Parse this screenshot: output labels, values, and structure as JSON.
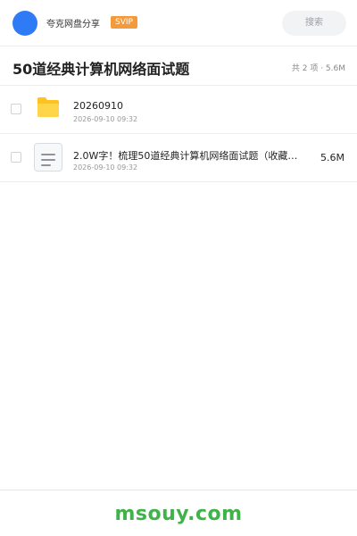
{
  "header": {
    "username": "夸克网盘分享",
    "badge": "SVIP",
    "search_placeholder": "搜索"
  },
  "titlebar": {
    "title": "50道经典计算机网络面试题",
    "meta": "共 2 项 · 5.6M"
  },
  "files": [
    {
      "type": "folder",
      "name": "20260910",
      "date": "2026-09-10 09:32",
      "size": ""
    },
    {
      "type": "document",
      "name": "2.0W字！梳理50道经典计算机网络面试题（收藏版…",
      "date": "2026-09-10 09:32",
      "size": "5.6M"
    }
  ],
  "footer": {
    "watermark": "msouy.com"
  },
  "colors": {
    "accent_blue": "#2f7bf5",
    "svip_orange": "#f39a3b",
    "folder_yellow": "#ffc31f",
    "watermark_green": "#3fb34a"
  }
}
